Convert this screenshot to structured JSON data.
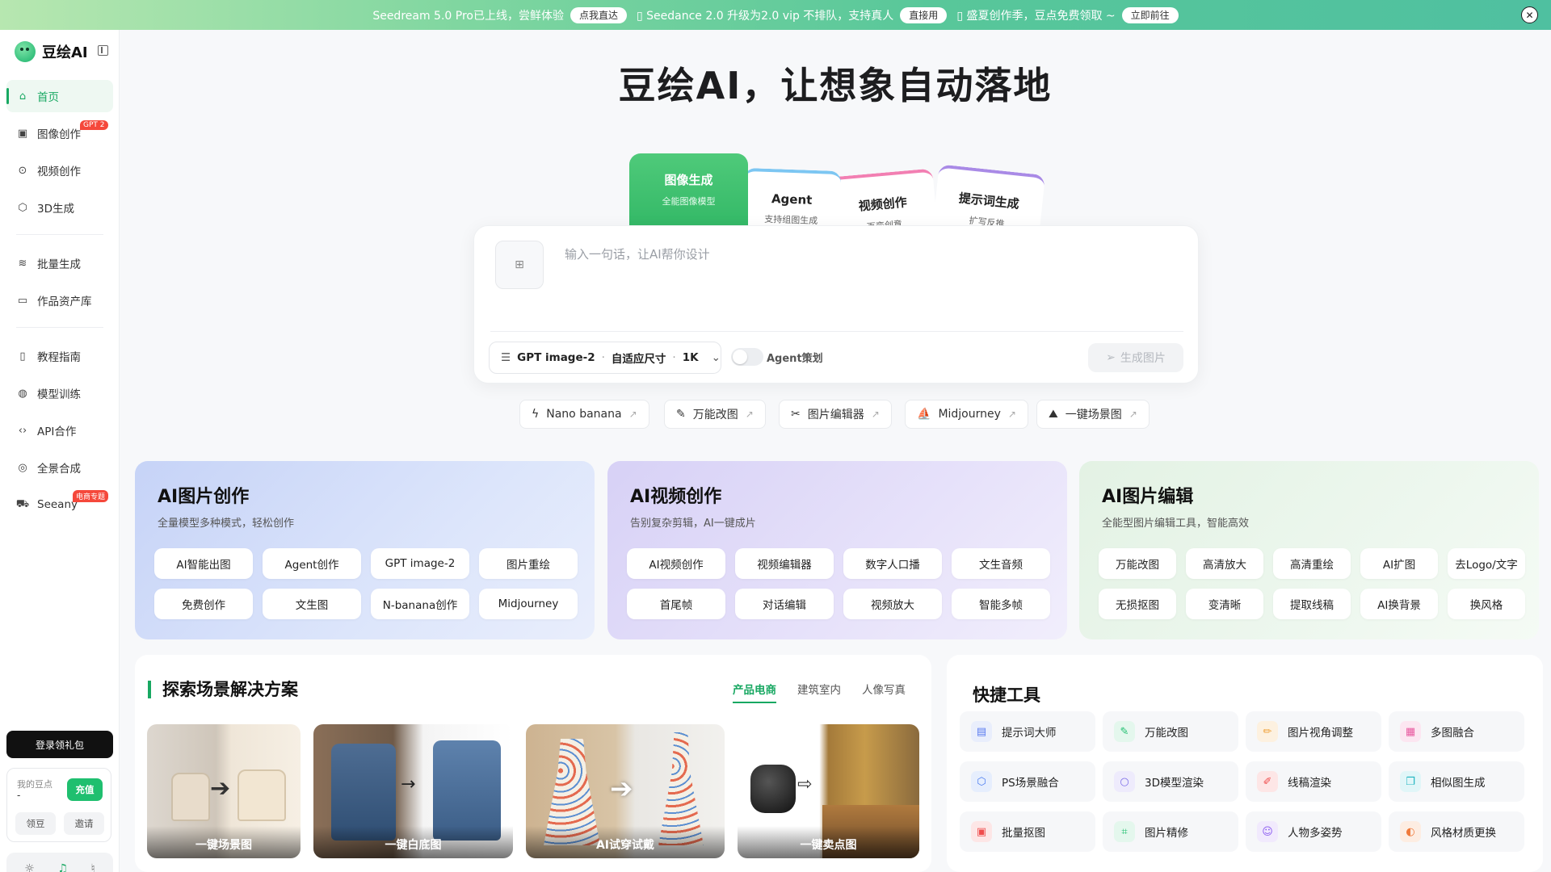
{
  "banner": {
    "seg1_text": "Seedream 5.0 Pro已上线，尝鲜体验",
    "seg1_btn": "点我直达",
    "seg2_text": "▯ Seedance 2.0 升级为2.0 vip 不排队，支持真人",
    "seg2_btn": "直接用",
    "seg3_text": "▯ 盛夏创作季，豆点免费领取 ~",
    "seg3_btn": "立即前往",
    "colors": {
      "start": "#b7e7b0",
      "end": "#4fc0a0"
    }
  },
  "sidebar": {
    "logo_text": "豆绘AI",
    "items": [
      {
        "label": "首页",
        "icon": "home-icon",
        "active": true
      },
      {
        "label": "图像创作",
        "icon": "image-icon",
        "badge": "GPT 2"
      },
      {
        "label": "视频创作",
        "icon": "play-icon"
      },
      {
        "label": "3D生成",
        "icon": "cube-icon"
      },
      {
        "label": "批量生成",
        "icon": "layers-icon"
      },
      {
        "label": "作品资产库",
        "icon": "folder-icon"
      },
      {
        "label": "教程指南",
        "icon": "book-icon"
      },
      {
        "label": "模型训练",
        "icon": "globe-icon"
      },
      {
        "label": "API合作",
        "icon": "code-icon"
      },
      {
        "label": "全景合成",
        "icon": "panorama-icon"
      },
      {
        "label": "Seeany",
        "icon": "cart-icon",
        "badge": "电商专题"
      }
    ],
    "login_label": "登录领礼包",
    "points": {
      "label": "我的豆点",
      "value": "-",
      "recharge": "充值",
      "claim": "领豆",
      "invite": "邀请"
    },
    "accent": "#18a862"
  },
  "hero": {
    "title": "豆绘AI，让想象自动落地"
  },
  "mode_tabs": [
    {
      "title": "图像生成",
      "subtitle": "全能图像模型"
    },
    {
      "title": "Agent",
      "subtitle": "支持组图生成"
    },
    {
      "title": "视频创作",
      "subtitle": "百变创意"
    },
    {
      "title": "提示词生成",
      "subtitle": "扩写反推"
    }
  ],
  "prompt": {
    "placeholder": "输入一句话，让AI帮你设计",
    "model": "GPT image-2",
    "size": "自适应尺寸",
    "resolution": "1K",
    "agent_toggle": "Agent策划",
    "agent_enabled": false,
    "generate": "生成图片"
  },
  "quick_chips": [
    {
      "label": "Nano banana",
      "icon": "bolt-icon"
    },
    {
      "label": "万能改图",
      "icon": "brush-icon"
    },
    {
      "label": "图片编辑器",
      "icon": "scissors-icon"
    },
    {
      "label": "Midjourney",
      "icon": "sail-icon"
    },
    {
      "label": "一键场景图",
      "icon": "mountain-icon"
    }
  ],
  "categories": [
    {
      "title": "AI图片创作",
      "subtitle": "全量模型多种模式，轻松创作",
      "buttons": [
        "AI智能出图",
        "Agent创作",
        "GPT image-2",
        "图片重绘",
        "免费创作",
        "文生图",
        "N-banana创作",
        "Midjourney"
      ]
    },
    {
      "title": "AI视频创作",
      "subtitle": "告别复杂剪辑，AI一键成片",
      "buttons": [
        "AI视频创作",
        "视频编辑器",
        "数字人口播",
        "文生音频",
        "首尾帧",
        "对话编辑",
        "视频放大",
        "智能多帧"
      ]
    },
    {
      "title": "AI图片编辑",
      "subtitle": "全能型图片编辑工具，智能高效",
      "buttons": [
        "万能改图",
        "高清放大",
        "高清重绘",
        "AI扩图",
        "去Logo/文字",
        "无损抠图",
        "变清晰",
        "提取线稿",
        "AI换背景",
        "换风格"
      ]
    }
  ],
  "scenes": {
    "title": "探索场景解决方案",
    "tabs": [
      "产品电商",
      "建筑室内",
      "人像写真"
    ],
    "cards": [
      "一键场景图",
      "一键白底图",
      "AI试穿试戴",
      "一键卖点图"
    ]
  },
  "tools": {
    "title": "快捷工具",
    "items": [
      {
        "label": "提示词大师",
        "icon": "doc-icon",
        "color": "#5b7cf0"
      },
      {
        "label": "万能改图",
        "icon": "brush-icon",
        "color": "#1fbf6f"
      },
      {
        "label": "图片视角调整",
        "icon": "pencil-icon",
        "color": "#f0a23b"
      },
      {
        "label": "多图融合",
        "icon": "grid-icon",
        "color": "#e85aa0"
      },
      {
        "label": "PS场景融合",
        "icon": "box-icon",
        "color": "#4a7cf0"
      },
      {
        "label": "3D模型渲染",
        "icon": "circle-icon",
        "color": "#7b6ce8"
      },
      {
        "label": "线稿渲染",
        "icon": "pen-icon",
        "color": "#ef4d4d"
      },
      {
        "label": "相似图生成",
        "icon": "copy-icon",
        "color": "#1fb5c0"
      },
      {
        "label": "批量抠图",
        "icon": "image-icon",
        "color": "#ef4d4d"
      },
      {
        "label": "图片精修",
        "icon": "scan-icon",
        "color": "#1fbf6f"
      },
      {
        "label": "人物多姿势",
        "icon": "person-icon",
        "color": "#8b5cf0"
      },
      {
        "label": "风格材质更换",
        "icon": "palette-icon",
        "color": "#f07a3b"
      }
    ]
  }
}
